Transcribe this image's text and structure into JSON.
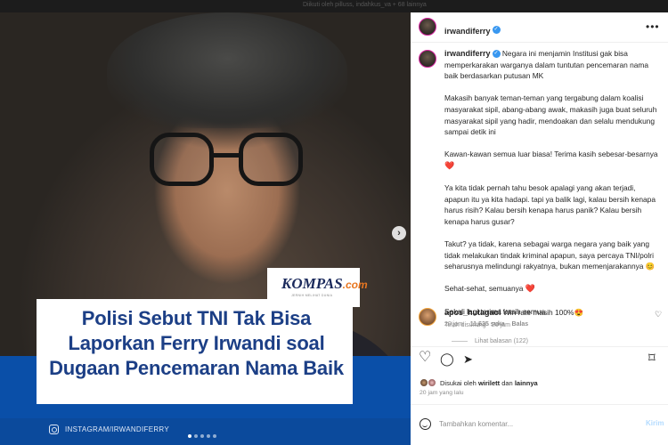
{
  "top_strip": {
    "text": "Diikuti oleh pilluss, indahkus_va + 68 lainnya"
  },
  "media": {
    "logo": {
      "main": "KOMPAS",
      "suffix": ".com",
      "tagline": "JERNIH MELIHAT DUNIA"
    },
    "headline_lines": [
      "Polisi Sebut TNI Tak Bisa",
      "Laporkan Ferry Irwandi soal",
      "Dugaan Pencemaran Nama Baik"
    ],
    "credit": "INSTAGRAM/IRWANDIFERRY",
    "carousel": {
      "total": 5,
      "active_index": 1
    },
    "next_icon": "chevron-right-icon",
    "next_glyph": "›"
  },
  "post": {
    "username": "irwandiferry",
    "verified_glyph": "✓",
    "more_glyph": "•••",
    "caption": {
      "username": "irwandiferry",
      "paragraphs": [
        "Negara ini menjamin Institusi gak bisa memperkarakan warganya dalam tuntutan pencemaran nama baik berdasarkan putusan MK",
        "Makasih banyak teman-teman yang tergabung dalam koalisi masyarakat sipil, abang-abang awak, makasih juga buat seluruh masyarakat sipil yang hadir, mendoakan dan selalu mendukung sampai detik ini",
        "Kawan-kawan semua luar biasa! Terima kasih sebesar-besarnya",
        "Ya kita tidak pernah tahu besok apalagi yang akan terjadi, apapun itu ya kita hadapi. tapi ya balik lagi, kalau bersih kenapa harus risih? Kalau bersih kenapa harus panik? Kalau bersih kenapa harus gusar?",
        "Takut? ya tidak, karena sebagai warga negara yang baik yang tidak melakukan tindak kriminal apapun, saya percaya TNI/polri seharusnya melindungi rakyatnya, bukan memenjarakannya 😊",
        "Sehat-sehat, semuanya",
        "Sekali lagi terima kasih semua"
      ],
      "heart": "❤️",
      "meta": "Telah disunting · 20 jam"
    },
    "comment": {
      "username": "apos_hutagaol",
      "text": "Win rate masih 100%😍",
      "time": "20 jam",
      "likes": "11,635 suka",
      "reply_label": "Balas",
      "heart_glyph": "♡",
      "view_replies": "Lihat balasan (122)"
    },
    "actions": {
      "like_glyph": "♡",
      "comment_glyph": "◯",
      "share_glyph": "➤",
      "save_glyph": "⌑"
    },
    "liked_by": {
      "prefix": "Disukai oleh",
      "user": "wirilett",
      "conj": "dan",
      "others": "lainnya"
    },
    "posted_ago": "20 jam yang lalu",
    "add_comment": {
      "placeholder": "Tambahkan komentar...",
      "send_label": "Kirim"
    }
  },
  "colors": {
    "accent_blue": "#0a4fa8",
    "headline_blue": "#1c3f86",
    "verified": "#3897f0",
    "heart": "#ed1c24",
    "send_disabled": "#b3dbff"
  }
}
